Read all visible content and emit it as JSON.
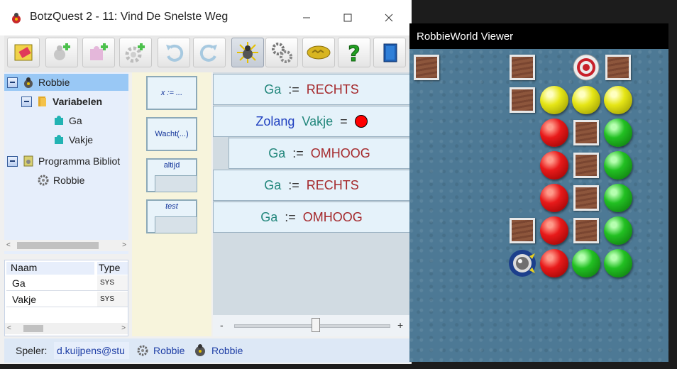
{
  "window": {
    "title": "BotzQuest 2 - 11: Vind De Snelste Weg",
    "minimize_icon": "minimize-icon",
    "maximize_icon": "maximize-icon",
    "close_icon": "close-icon"
  },
  "toolbar": {
    "buttons": [
      {
        "name": "erase-button",
        "icon": "eraser-icon"
      },
      {
        "name": "add-robot-button",
        "icon": "robot-add-icon"
      },
      {
        "name": "add-variable-button",
        "icon": "puzzle-add-icon"
      },
      {
        "name": "add-routine-button",
        "icon": "gear-add-icon"
      },
      {
        "name": "undo-button",
        "icon": "undo-icon"
      },
      {
        "name": "redo-button",
        "icon": "redo-icon"
      },
      {
        "name": "run-button",
        "icon": "robbie-icon"
      },
      {
        "name": "settings-button",
        "icon": "gears-icon"
      },
      {
        "name": "badge-button",
        "icon": "badge-icon"
      },
      {
        "name": "help-button",
        "icon": "question-icon"
      },
      {
        "name": "book-button",
        "icon": "book-icon"
      }
    ]
  },
  "tree": {
    "root": "Robbie",
    "variables_folder": "Variabelen",
    "variables": [
      "Ga",
      "Vakje"
    ],
    "library": "Programma Bibliot",
    "library_items": [
      "Robbie"
    ]
  },
  "var_table": {
    "headers": [
      "Naam",
      "Type"
    ],
    "rows": [
      {
        "name": "Ga",
        "type": "SYS"
      },
      {
        "name": "Vakje",
        "type": "SYS"
      }
    ]
  },
  "palette": {
    "assign": "x := ...",
    "wait": "Wacht(...)",
    "always": "altijd",
    "test": "test"
  },
  "program": {
    "stmt1": {
      "var": "Ga",
      "op": ":=",
      "val": "RECHTS"
    },
    "loop": {
      "kw": "Zolang",
      "var": "Vakje",
      "op": "=",
      "val_color": "#ff0000"
    },
    "stmt2": {
      "var": "Ga",
      "op": ":=",
      "val": "OMHOOG"
    },
    "stmt3": {
      "var": "Ga",
      "op": ":=",
      "val": "RECHTS"
    },
    "stmt4": {
      "var": "Ga",
      "op": ":=",
      "val": "OMHOOG"
    }
  },
  "zoom": {
    "minus": "-",
    "plus": "+",
    "level": 0.5
  },
  "status": {
    "player_label": "Speler:",
    "player_value": "d.kuijpens@stu",
    "routine": "Robbie",
    "robot": "Robbie"
  },
  "viewer": {
    "title": "RobbieWorld Viewer",
    "grid": [
      [
        "box",
        "",
        "box",
        "",
        "target",
        "box"
      ],
      [
        "",
        "",
        "box",
        "yellow",
        "yellow",
        "yellow"
      ],
      [
        "",
        "",
        "",
        "red",
        "box",
        "green"
      ],
      [
        "",
        "",
        "",
        "red",
        "box",
        "green"
      ],
      [
        "",
        "",
        "",
        "red",
        "box",
        "green"
      ],
      [
        "",
        "",
        "box",
        "red",
        "box",
        "green"
      ],
      [
        "",
        "",
        "robot",
        "red",
        "green",
        "green"
      ]
    ]
  }
}
